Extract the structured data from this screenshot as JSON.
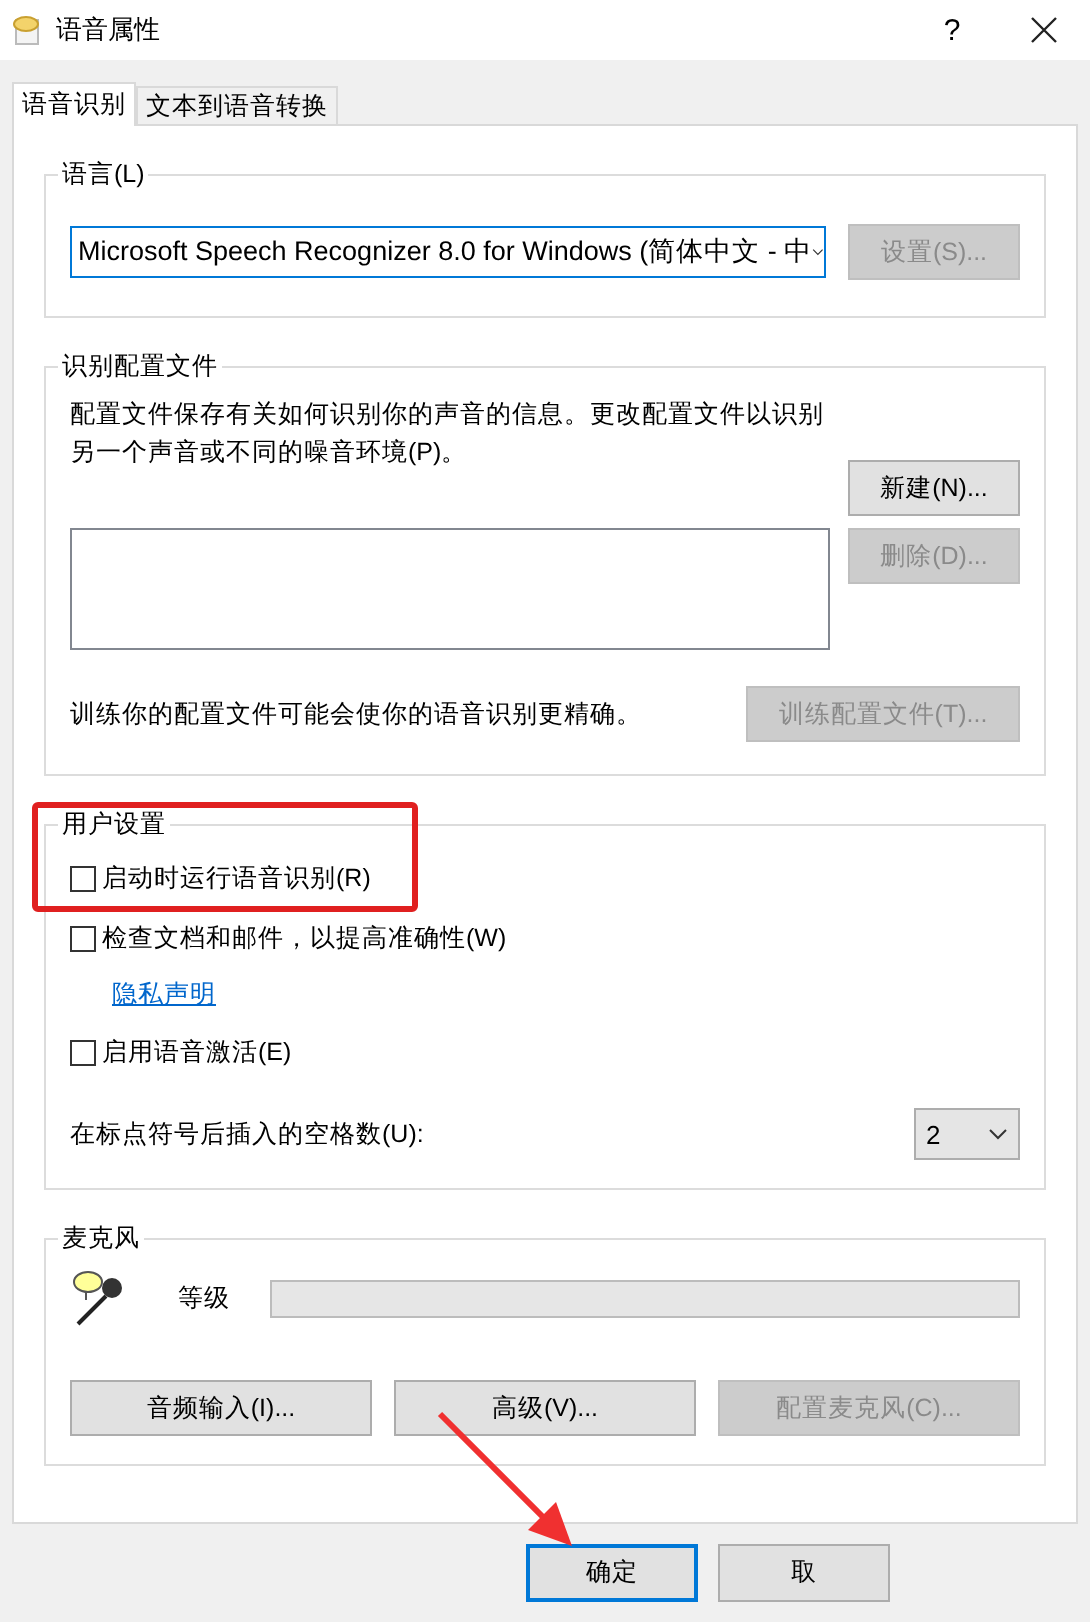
{
  "window": {
    "title": "语音属性",
    "help": "?"
  },
  "tabs": [
    {
      "label": "语音识别",
      "selected": true
    },
    {
      "label": "文本到语音转换",
      "selected": false
    }
  ],
  "language": {
    "legend": "语言(L)",
    "value": "Microsoft Speech Recognizer 8.0 for Windows (简体中文 - 中",
    "settings_button": {
      "label": "设置(S)...",
      "disabled": true
    }
  },
  "profiles": {
    "legend": "识别配置文件",
    "description": "配置文件保存有关如何识别你的声音的信息。更改配置文件以识别另一个声音或不同的噪音环境(P)。",
    "new_button": {
      "label": "新建(N)...",
      "disabled": false
    },
    "delete_button": {
      "label": "删除(D)...",
      "disabled": true
    },
    "hint": "训练你的配置文件可能会使你的语音识别更精确。",
    "train_button": {
      "label": "训练配置文件(T)...",
      "disabled": true
    }
  },
  "user_settings": {
    "legend": "用户设置",
    "options": [
      {
        "kind": "checkbox",
        "label": "启动时运行语音识别(R)",
        "checked": false
      },
      {
        "kind": "checkbox",
        "label": "检查文档和邮件，以提高准确性(W)",
        "checked": false
      },
      {
        "kind": "link",
        "label": "隐私声明"
      },
      {
        "kind": "checkbox",
        "label": "启用语音激活(E)",
        "checked": false
      }
    ],
    "spaces_label": "在标点符号后插入的空格数(U):",
    "spaces_value": "2"
  },
  "microphone": {
    "legend": "麦克风",
    "level_label": "等级",
    "level": 0,
    "buttons": [
      {
        "label": "音频输入(I)...",
        "disabled": false
      },
      {
        "label": "高级(V)...",
        "disabled": false
      },
      {
        "label": "配置麦克风(C)...",
        "disabled": true
      }
    ]
  },
  "footer_buttons": [
    {
      "label": "确定",
      "selected": true
    },
    {
      "label": "取",
      "selected": false
    }
  ],
  "annotations": {
    "highlight_box": true,
    "arrow": true
  }
}
